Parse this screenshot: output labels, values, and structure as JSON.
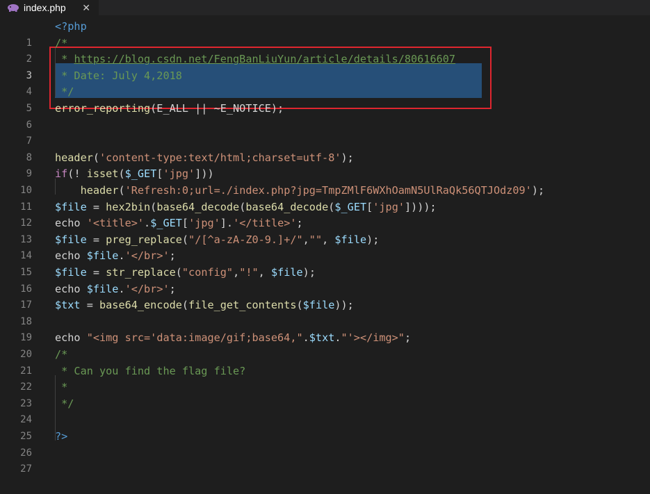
{
  "tab": {
    "filename": "index.php",
    "close_glyph": "✕",
    "icon": "php-elephant-icon"
  },
  "lines": [
    {
      "n": "1"
    },
    {
      "n": "2"
    },
    {
      "n": "3"
    },
    {
      "n": "4"
    },
    {
      "n": "5"
    },
    {
      "n": "6"
    },
    {
      "n": "7"
    },
    {
      "n": "8"
    },
    {
      "n": "9"
    },
    {
      "n": "10"
    },
    {
      "n": "11"
    },
    {
      "n": "12"
    },
    {
      "n": "13"
    },
    {
      "n": "14"
    },
    {
      "n": "15"
    },
    {
      "n": "16"
    },
    {
      "n": "17"
    },
    {
      "n": "18"
    },
    {
      "n": "19"
    },
    {
      "n": "20"
    },
    {
      "n": "21"
    },
    {
      "n": "22"
    },
    {
      "n": "23"
    },
    {
      "n": "24"
    },
    {
      "n": "25"
    },
    {
      "n": "26"
    },
    {
      "n": "27"
    }
  ],
  "code": {
    "l1": "<?php",
    "l2": "/*",
    "l3_star": " * ",
    "l3_url": "https://blog.csdn.net/FengBanLiuYun/article/details/80616607",
    "l4": " * Date: July 4,2018",
    "l5": " */",
    "l6_fn": "error_reporting",
    "l6_rest": "(E_ALL || ~E_NOTICE);",
    "l9_fn": "header",
    "l9_open": "(",
    "l9_str": "'content-type:text/html;charset=utf-8'",
    "l9_close": ");",
    "l10_if": "if",
    "l10_a": "(! ",
    "l10_isset": "isset",
    "l10_b": "(",
    "l10_var": "$_GET",
    "l10_c": "[",
    "l10_str": "'jpg'",
    "l10_d": "]))",
    "l11_indent": "    ",
    "l11_fn": "header",
    "l11_open": "(",
    "l11_str": "'Refresh:0;url=./index.php?jpg=TmpZMlF6WXhOamN5UlRaQk56QTJOdz09'",
    "l11_close": ");",
    "l12_var": "$file",
    "l12_eq": " = ",
    "l12_f1": "hex2bin",
    "l12_p1": "(",
    "l12_f2": "base64_decode",
    "l12_p2": "(",
    "l12_f3": "base64_decode",
    "l12_p3": "(",
    "l12_g": "$_GET",
    "l12_p4": "[",
    "l12_str": "'jpg'",
    "l12_p5": "])));",
    "l13_echo": "echo",
    "l13_sp": " ",
    "l13_s1": "'<title>'",
    "l13_dot": ".",
    "l13_g": "$_GET",
    "l13_b1": "[",
    "l13_s2": "'jpg'",
    "l13_b2": "].",
    "l13_s3": "'</title>'",
    "l13_end": ";",
    "l14_var": "$file",
    "l14_eq": " = ",
    "l14_fn": "preg_replace",
    "l14_p": "(",
    "l14_s1": "\"/[^a-zA-Z0-9.]+/\"",
    "l14_c": ",",
    "l14_s2": "\"\"",
    "l14_c2": ", ",
    "l14_v": "$file",
    "l14_end": ");",
    "l15_echo": "echo",
    "l15_sp": " ",
    "l15_v": "$file",
    "l15_dot": ".",
    "l15_s": "'</br>'",
    "l15_end": ";",
    "l16_var": "$file",
    "l16_eq": " = ",
    "l16_fn": "str_replace",
    "l16_p": "(",
    "l16_s1": "\"config\"",
    "l16_c": ",",
    "l16_s2": "\"!\"",
    "l16_c2": ", ",
    "l16_v": "$file",
    "l16_end": ");",
    "l17_echo": "echo",
    "l17_sp": " ",
    "l17_v": "$file",
    "l17_dot": ".",
    "l17_s": "'</br>'",
    "l17_end": ";",
    "l18_var": "$txt",
    "l18_eq": " = ",
    "l18_f1": "base64_encode",
    "l18_p1": "(",
    "l18_f2": "file_get_contents",
    "l18_p2": "(",
    "l18_v": "$file",
    "l18_end": "));",
    "l20_echo": "echo",
    "l20_sp": " ",
    "l20_s1": "\"<img src='data:image/gif;base64,\"",
    "l20_dot1": ".",
    "l20_v": "$txt",
    "l20_dot2": ".",
    "l20_s2": "\"'></img>\"",
    "l20_end": ";",
    "l21": "/*",
    "l22": " * Can you find the flag file?",
    "l23": " *",
    "l24": " */",
    "l26": "?>"
  },
  "colors": {
    "background": "#1e1e1e",
    "highlight_box": "#e0262f",
    "selection": "#264f78"
  }
}
